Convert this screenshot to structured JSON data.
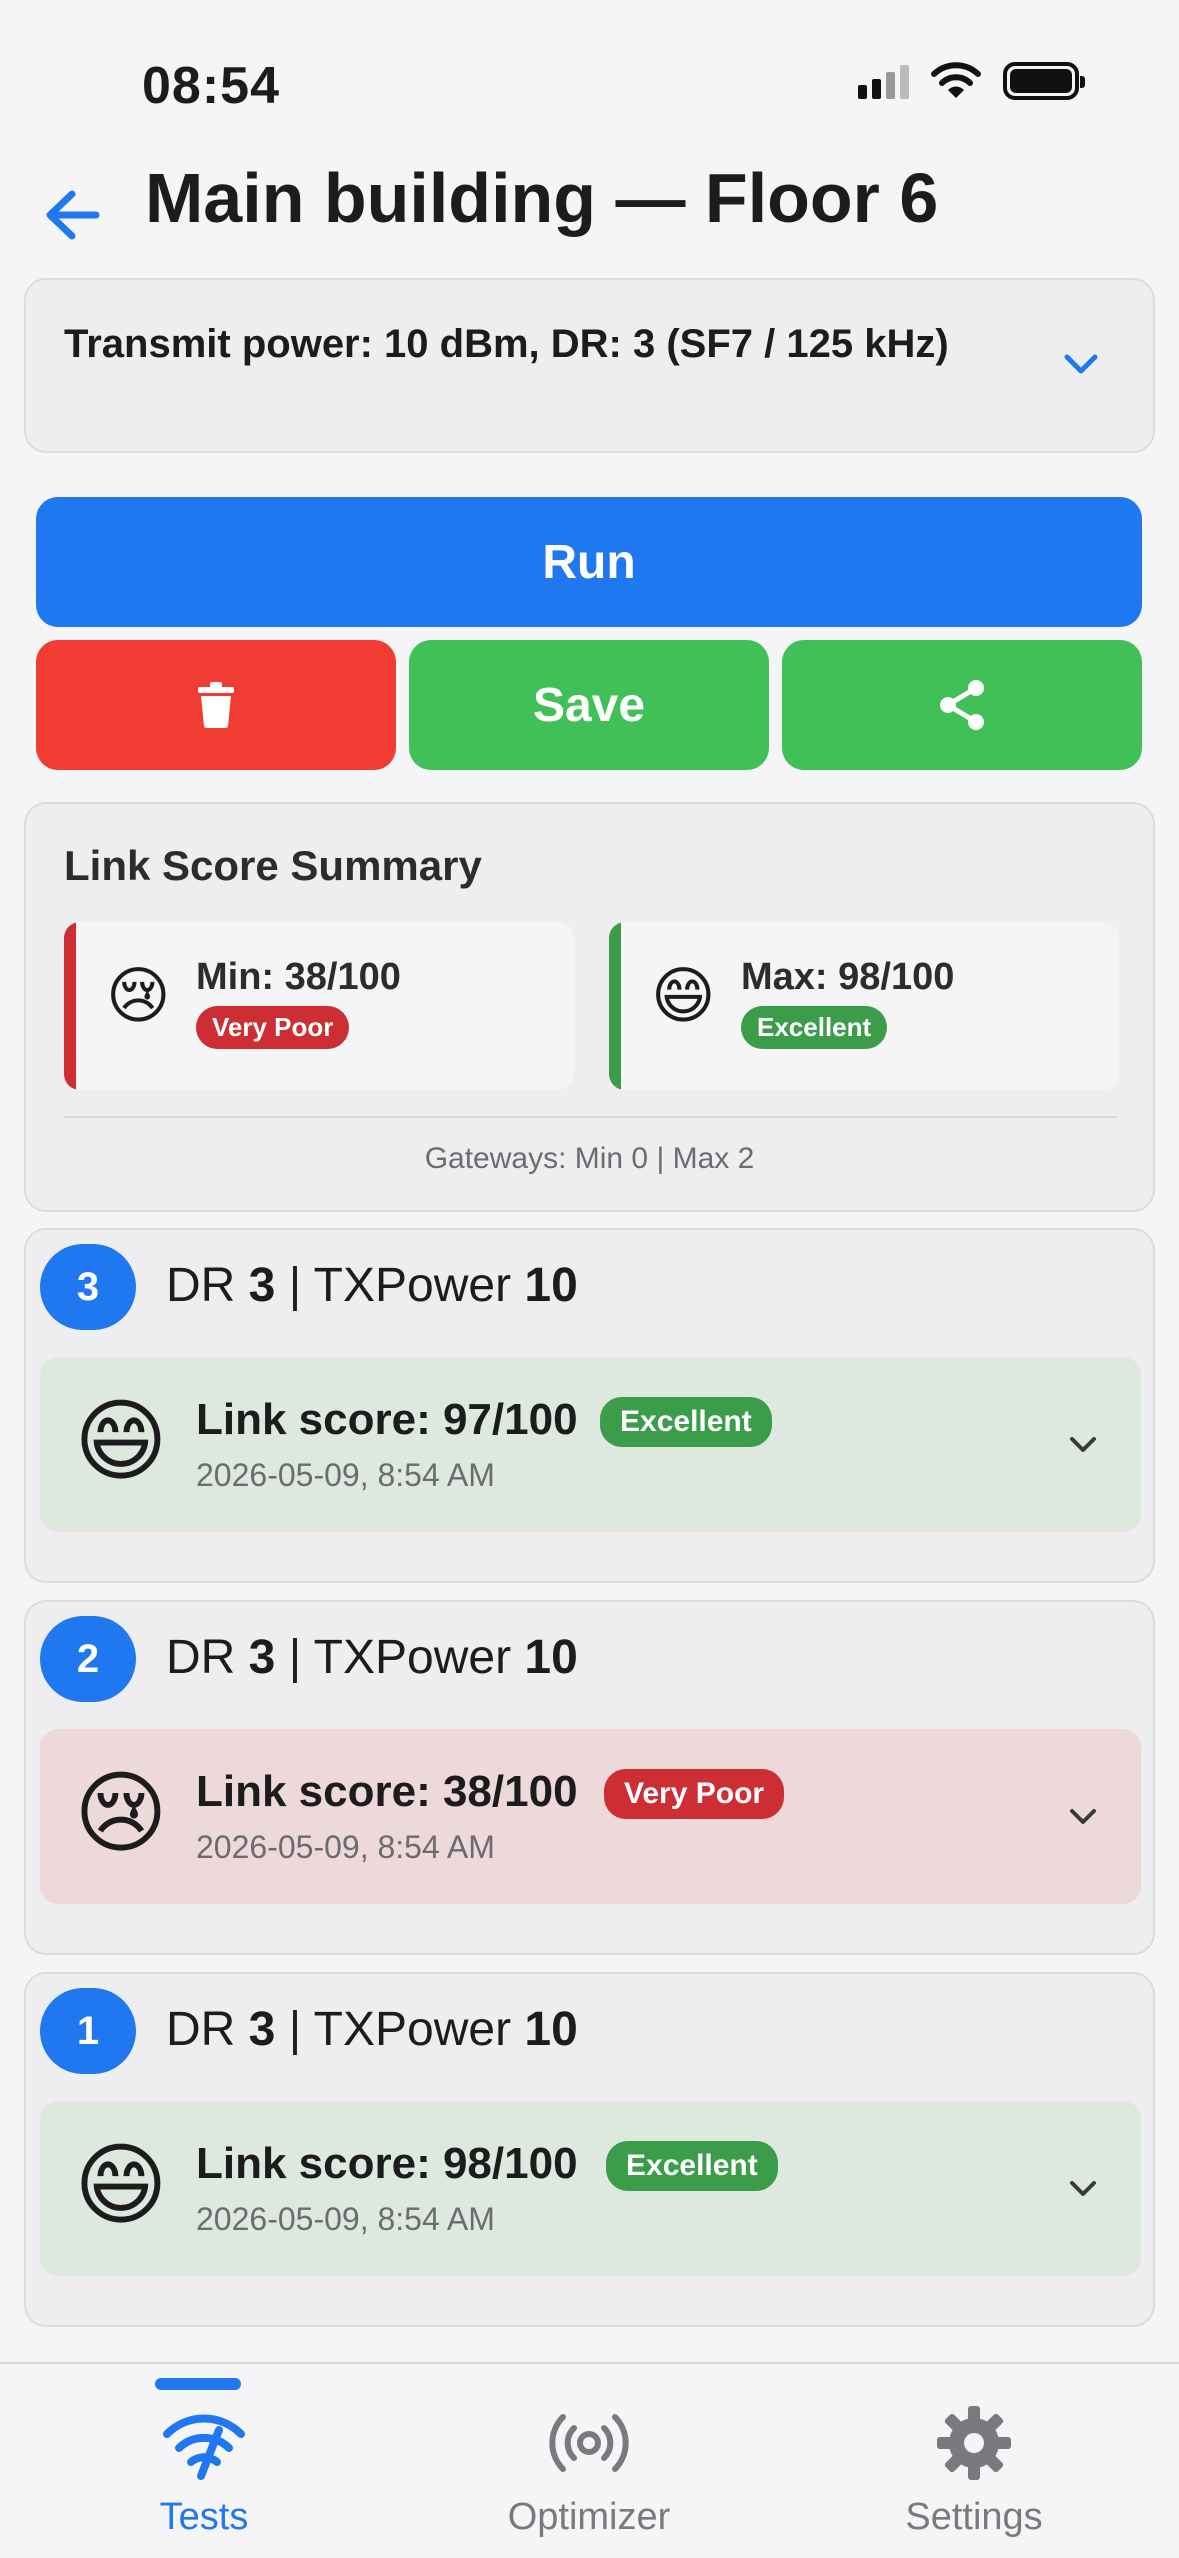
{
  "status_bar": {
    "time": "08:54"
  },
  "header": {
    "title": "Main building — Floor 6"
  },
  "config": {
    "text": "Transmit power: 10 dBm, DR: 3 (SF7 / 125 kHz)"
  },
  "actions": {
    "run_label": "Run",
    "save_label": "Save"
  },
  "summary": {
    "title": "Link Score Summary",
    "min": {
      "label": "Min: 38/100",
      "badge": "Very Poor",
      "emoji": "😢"
    },
    "max": {
      "label": "Max: 98/100",
      "badge": "Excellent",
      "emoji": "😄"
    },
    "gateways": "Gateways: Min 0 | Max 2"
  },
  "runs": [
    {
      "number": "3",
      "dr_label": "DR",
      "dr": "3",
      "sep": "|",
      "tx_label": "TXPower",
      "tx": "10",
      "emoji": "😄",
      "score": "Link score: 97/100",
      "badge": "Excellent",
      "date": "2026-05-09, 8:54 AM"
    },
    {
      "number": "2",
      "dr_label": "DR",
      "dr": "3",
      "sep": "|",
      "tx_label": "TXPower",
      "tx": "10",
      "emoji": "😢",
      "score": "Link score: 38/100",
      "badge": "Very Poor",
      "date": "2026-05-09, 8:54 AM"
    },
    {
      "number": "1",
      "dr_label": "DR",
      "dr": "3",
      "sep": "|",
      "tx_label": "TXPower",
      "tx": "10",
      "emoji": "😄",
      "score": "Link score: 98/100",
      "badge": "Excellent",
      "date": "2026-05-09, 8:54 AM"
    }
  ],
  "tabs": [
    {
      "label": "Tests",
      "icon": "wifi-signal-icon",
      "active": true
    },
    {
      "label": "Optimizer",
      "icon": "broadcast-icon",
      "active": false
    },
    {
      "label": "Settings",
      "icon": "gear-icon",
      "active": false
    }
  ],
  "colors": {
    "accent": "#1f78f0",
    "danger": "#f13c33",
    "success": "#40c057",
    "badge_excellent": "#3b9c4a",
    "badge_very_poor": "#cc2e33"
  }
}
